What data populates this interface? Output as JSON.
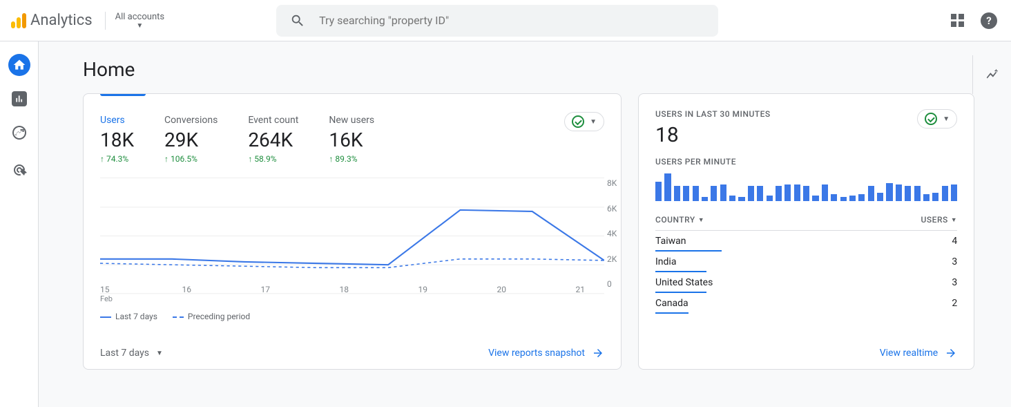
{
  "header": {
    "product": "Analytics",
    "account_selector": "All accounts",
    "search_placeholder": "Try searching \"property ID\""
  },
  "page": {
    "title": "Home"
  },
  "metrics": [
    {
      "label": "Users",
      "value": "18K",
      "delta": "74.3%",
      "active": true
    },
    {
      "label": "Conversions",
      "value": "29K",
      "delta": "106.5%",
      "active": false
    },
    {
      "label": "Event count",
      "value": "264K",
      "delta": "58.9%",
      "active": false
    },
    {
      "label": "New users",
      "value": "16K",
      "delta": "89.3%",
      "active": false
    }
  ],
  "chart_data": {
    "type": "line",
    "xlabel": "",
    "ylabel": "",
    "categories": [
      "15",
      "16",
      "17",
      "18",
      "19",
      "20",
      "21"
    ],
    "month_label": "Feb",
    "ylim": [
      0,
      8000
    ],
    "yticks": [
      "8K",
      "6K",
      "4K",
      "2K",
      "0"
    ],
    "series": [
      {
        "name": "Last 7 days",
        "style": "solid",
        "values": [
          2400,
          2400,
          2200,
          2100,
          2000,
          5800,
          5700,
          2300
        ]
      },
      {
        "name": "Preceding period",
        "style": "dashed",
        "values": [
          2100,
          2000,
          1900,
          1800,
          1800,
          2400,
          2400,
          2300
        ]
      }
    ]
  },
  "range_selector": "Last 7 days",
  "main_footer_link": "View reports snapshot",
  "realtime": {
    "title": "USERS IN LAST 30 MINUTES",
    "value": "18",
    "per_minute_title": "USERS PER MINUTE",
    "bars": [
      28,
      40,
      22,
      22,
      22,
      6,
      22,
      24,
      8,
      6,
      22,
      22,
      8,
      22,
      24,
      24,
      22,
      8,
      24,
      10,
      6,
      8,
      10,
      22,
      12,
      26,
      24,
      22,
      22,
      10,
      12,
      22,
      24
    ],
    "columns": {
      "left": "COUNTRY",
      "right": "USERS"
    },
    "rows": [
      {
        "country": "Taiwan",
        "users": "4",
        "width": 22
      },
      {
        "country": "India",
        "users": "3",
        "width": 17
      },
      {
        "country": "United States",
        "users": "3",
        "width": 17
      },
      {
        "country": "Canada",
        "users": "2",
        "width": 11
      }
    ],
    "footer_link": "View realtime"
  }
}
